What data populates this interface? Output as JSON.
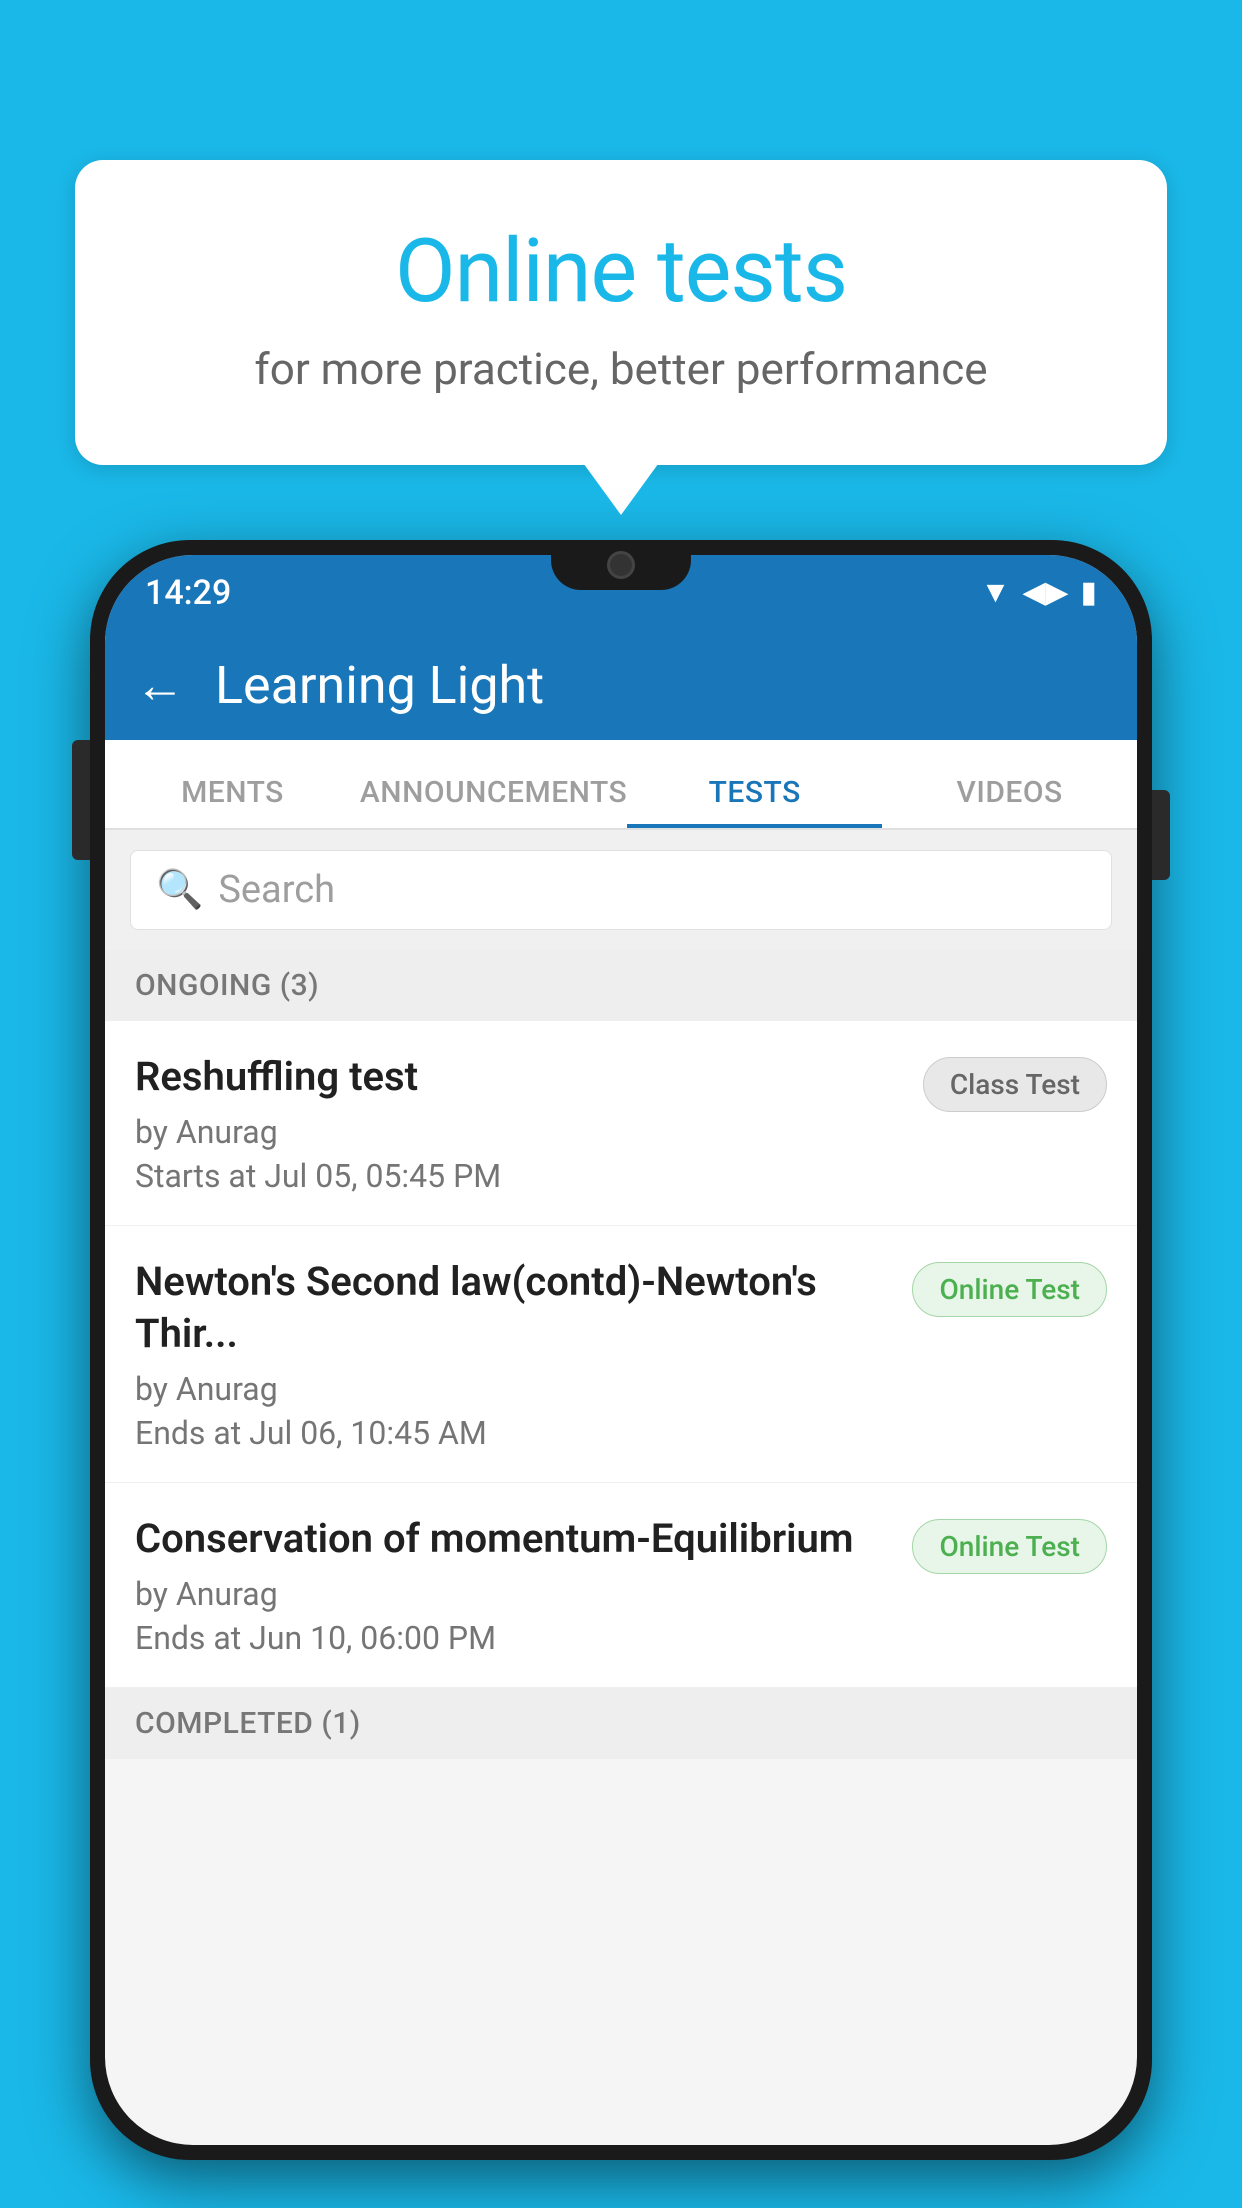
{
  "background_color": "#1ab8e8",
  "speech_bubble": {
    "title": "Online tests",
    "subtitle": "for more practice, better performance"
  },
  "phone": {
    "status_bar": {
      "time": "14:29",
      "wifi": "▼",
      "signal": "▲",
      "battery": "▌"
    },
    "header": {
      "back_label": "←",
      "title": "Learning Light"
    },
    "tabs": [
      {
        "label": "MENTS",
        "active": false
      },
      {
        "label": "ANNOUNCEMENTS",
        "active": false
      },
      {
        "label": "TESTS",
        "active": true
      },
      {
        "label": "VIDEOS",
        "active": false
      }
    ],
    "search": {
      "placeholder": "Search"
    },
    "sections": {
      "ongoing": {
        "title": "ONGOING (3)",
        "tests": [
          {
            "name": "Reshuffling test",
            "author": "by Anurag",
            "time": "Starts at  Jul 05, 05:45 PM",
            "badge": "Class Test",
            "badge_type": "class"
          },
          {
            "name": "Newton's Second law(contd)-Newton's Thir...",
            "author": "by Anurag",
            "time": "Ends at  Jul 06, 10:45 AM",
            "badge": "Online Test",
            "badge_type": "online"
          },
          {
            "name": "Conservation of momentum-Equilibrium",
            "author": "by Anurag",
            "time": "Ends at  Jun 10, 06:00 PM",
            "badge": "Online Test",
            "badge_type": "online"
          }
        ]
      },
      "completed": {
        "title": "COMPLETED (1)"
      }
    }
  }
}
